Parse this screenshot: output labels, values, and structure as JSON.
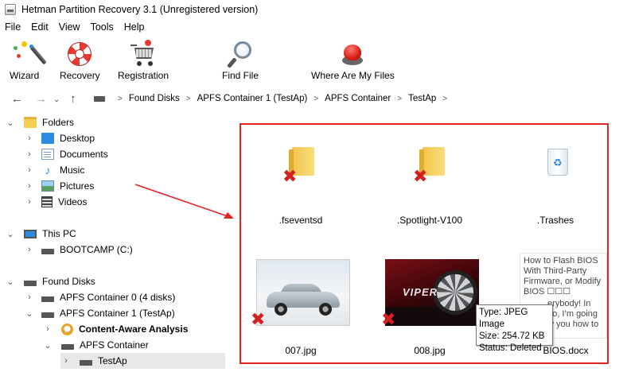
{
  "window": {
    "title": "Hetman Partition Recovery 3.1 (Unregistered version)"
  },
  "menu": [
    "File",
    "Edit",
    "View",
    "Tools",
    "Help"
  ],
  "toolbar": {
    "wizard": "Wizard",
    "recovery": "Recovery",
    "registration": "Registration",
    "find_file": "Find File",
    "where_files": "Where Are My Files"
  },
  "address": {
    "crumbs": [
      "Found Disks",
      "APFS Container 1 (TestAp)",
      "APFS Container",
      "TestAp"
    ]
  },
  "tree": {
    "folders": "Folders",
    "desktop": "Desktop",
    "documents": "Documents",
    "music": "Music",
    "pictures": "Pictures",
    "videos": "Videos",
    "this_pc": "This PC",
    "bootcamp": "BOOTCAMP (C:)",
    "found_disks": "Found Disks",
    "apfs0": "APFS Container 0 (4 disks)",
    "apfs1": "APFS Container 1 (TestAp)",
    "content_aware": "Content-Aware Analysis",
    "apfs_container": "APFS Container",
    "testap": "TestAp"
  },
  "files": {
    "f1": ".fseventsd",
    "f2": ".Spotlight-V100",
    "f3": ".Trashes",
    "f4": "007.jpg",
    "f5": "008.jpg",
    "f6": "BIOS.docx"
  },
  "doc_preview": {
    "line1": "How to Flash BIOS",
    "line2": "With Third-Party",
    "line3": "Firmware, or Modify",
    "line4": "BIOS ☐☐☐",
    "line5": "erybody! In",
    "line6": "eo, I’m going",
    "line7": "w you how to"
  },
  "car_logo": "VIPER",
  "tooltip": {
    "type": "Type: JPEG Image",
    "size": "Size: 254.72 KB",
    "status": "Status: Deleted"
  },
  "colors": {
    "highlight_border": "#e32222",
    "deleted_mark": "#d42020"
  }
}
